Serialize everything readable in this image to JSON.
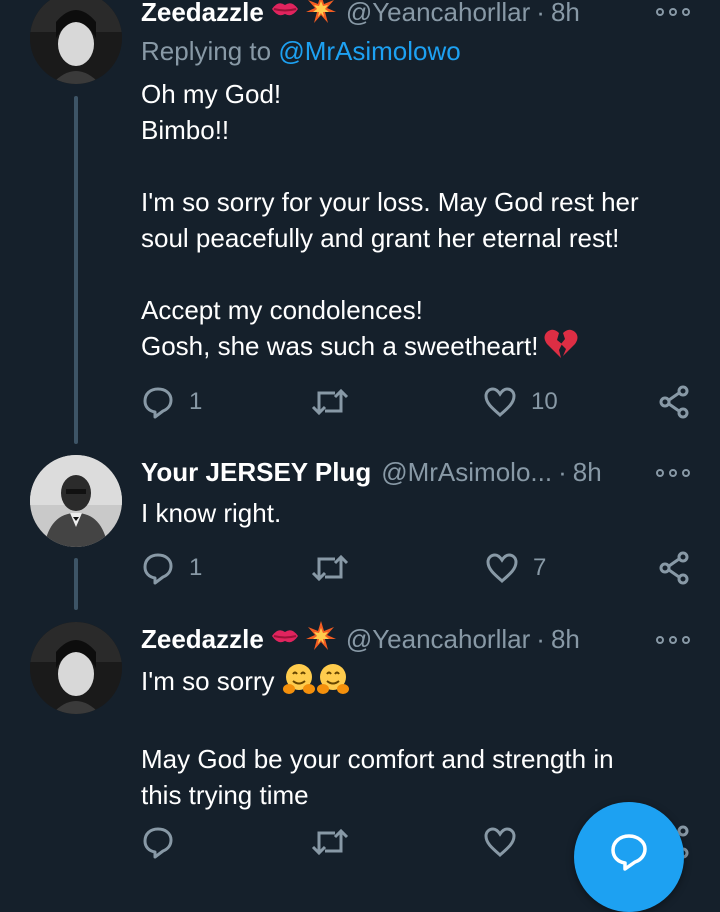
{
  "tweets": [
    {
      "name": "Zeedazzle",
      "emojis": [
        "kiss-mark",
        "collision"
      ],
      "handle": "@Yeancahorllar",
      "dot": "·",
      "time": "8h",
      "replying_prefix": "Replying to",
      "replying_to": "@MrAsimolowo",
      "lines": [
        "Oh my God!",
        "Bimbo!!",
        "",
        "I'm so sorry for your loss. May God rest her",
        "soul peacefully and grant her eternal rest!",
        "",
        "Accept my condolences!",
        "Gosh, she was such a sweetheart!"
      ],
      "reply_count": "1",
      "like_count": "10"
    },
    {
      "name": "Your JERSEY Plug",
      "handle": "@MrAsimolo...",
      "dot": "·",
      "time": "8h",
      "lines": [
        "I know right."
      ],
      "reply_count": "1",
      "like_count": "7"
    },
    {
      "name": "Zeedazzle",
      "emojis": [
        "kiss-mark",
        "collision"
      ],
      "handle": "@Yeancahorllar",
      "dot": "·",
      "time": "8h",
      "lines": [
        "I'm so sorry",
        "",
        "May God be your comfort and strength in",
        "this trying time"
      ],
      "reply_count": "",
      "like_count": ""
    }
  ],
  "colors": {
    "background": "#15202b",
    "muted": "#8899a6",
    "accent": "#1da1f2"
  }
}
